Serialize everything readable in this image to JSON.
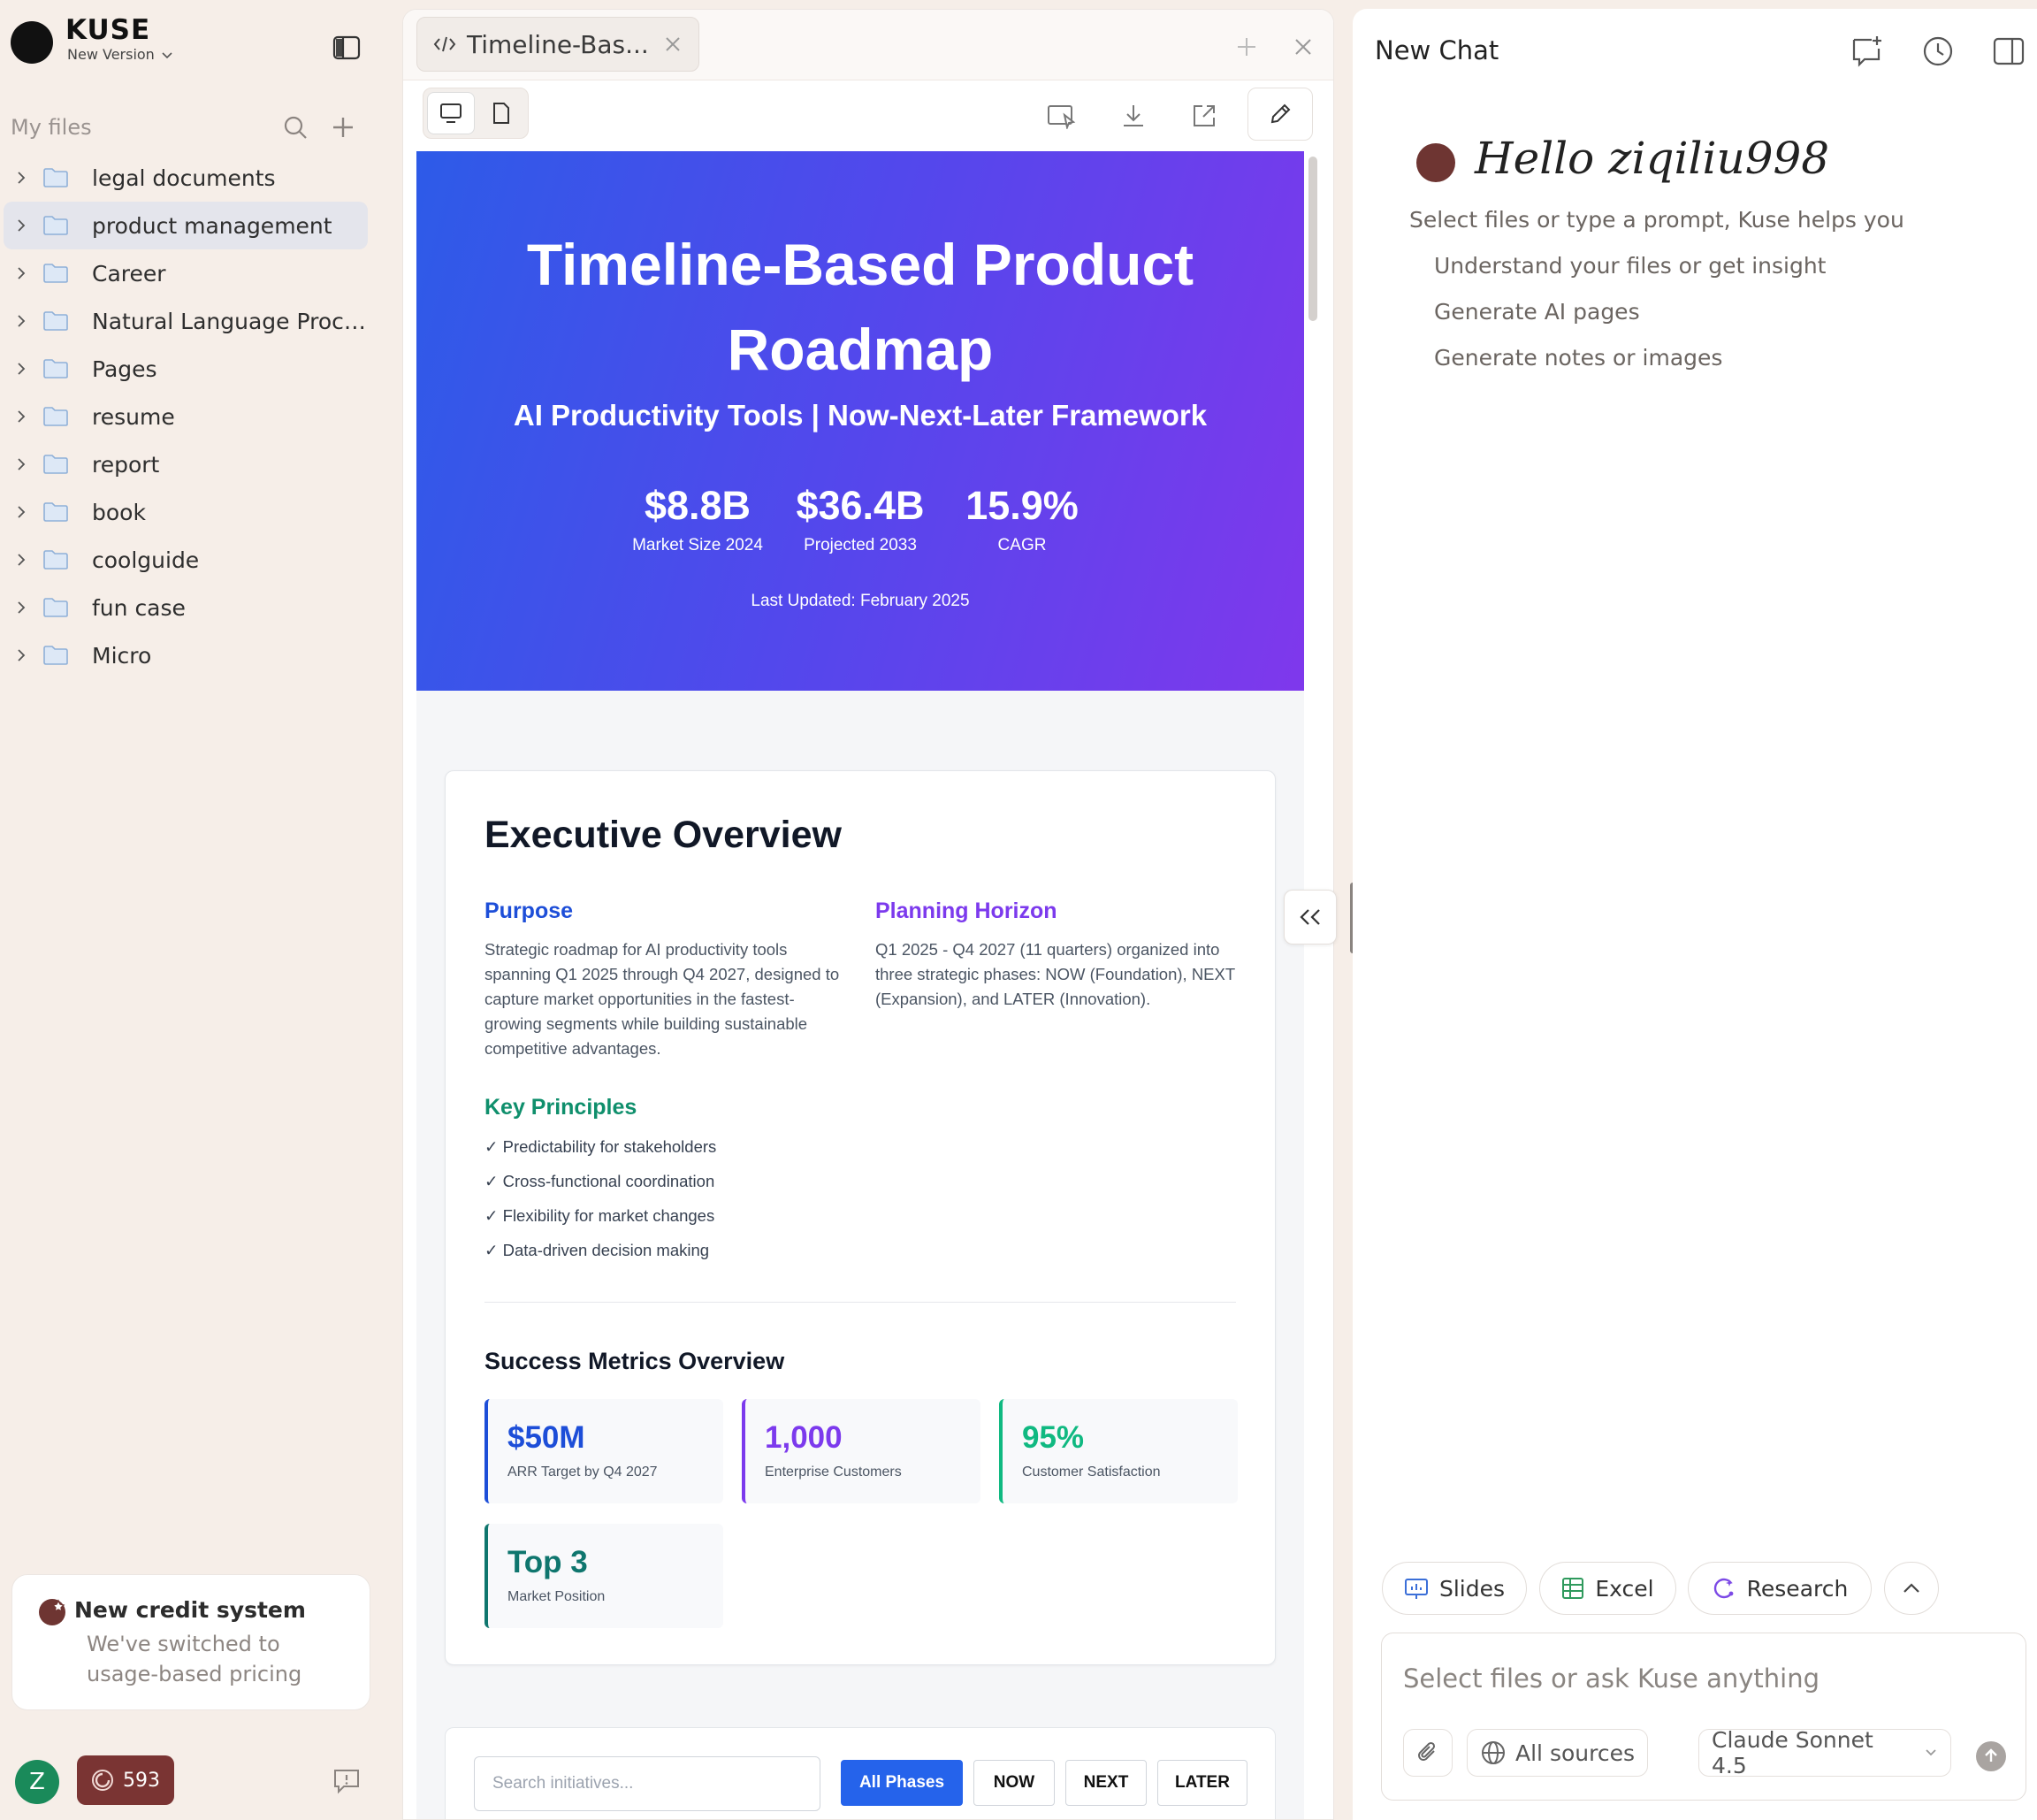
{
  "sidebar": {
    "brand": "KUSE",
    "version_label": "New Version",
    "section_label": "My files",
    "items": [
      {
        "label": "legal documents"
      },
      {
        "label": "product management"
      },
      {
        "label": "Career"
      },
      {
        "label": "Natural Language Proce..."
      },
      {
        "label": "Pages"
      },
      {
        "label": "resume"
      },
      {
        "label": "report"
      },
      {
        "label": "book"
      },
      {
        "label": "coolguide"
      },
      {
        "label": "fun case"
      },
      {
        "label": "Micro"
      }
    ],
    "active_item": "product management",
    "credit_notice": {
      "title": "New credit system",
      "description": "We've switched to usage-based pricing"
    },
    "avatar_initial": "Z",
    "credits": "593"
  },
  "center": {
    "tab_title": "Timeline-Bas...",
    "page": {
      "hero": {
        "title": "Timeline-Based Product Roadmap",
        "subtitle": "AI Productivity Tools | Now-Next-Later Framework",
        "stats": [
          {
            "value": "$8.8B",
            "label": "Market Size 2024"
          },
          {
            "value": "$36.4B",
            "label": "Projected 2033"
          },
          {
            "value": "15.9%",
            "label": "CAGR"
          }
        ],
        "updated": "Last Updated: February 2025"
      },
      "overview": {
        "title": "Executive Overview",
        "purpose_heading": "Purpose",
        "purpose_text": "Strategic roadmap for AI productivity tools spanning Q1 2025 through Q4 2027, designed to capture market opportunities in the fastest-growing segments while building sustainable competitive advantages.",
        "horizon_heading": "Planning Horizon",
        "horizon_text": "Q1 2025 - Q4 2027 (11 quarters) organized into three strategic phases: NOW (Foundation), NEXT (Expansion), and LATER (Innovation).",
        "principles_heading": "Key Principles",
        "principles": [
          "✓ Predictability for stakeholders",
          "✓ Cross-functional coordination",
          "✓ Flexibility for market changes",
          "✓ Data-driven decision making"
        ],
        "metrics_heading": "Success Metrics Overview",
        "metrics": [
          {
            "value": "$50M",
            "label": "ARR Target by Q4 2027",
            "color": "#1d4ed8"
          },
          {
            "value": "1,000",
            "label": "Enterprise Customers",
            "color": "#7c3aed"
          },
          {
            "value": "95%",
            "label": "Customer Satisfaction",
            "color": "#10b981"
          },
          {
            "value": "Top 3",
            "label": "Market Position",
            "color": "#0f766e"
          }
        ]
      },
      "filter": {
        "search_placeholder": "Search initiatives...",
        "phases": [
          "All Phases",
          "NOW",
          "NEXT",
          "LATER"
        ],
        "selected_phase": "All Phases"
      }
    }
  },
  "chat": {
    "title": "New Chat",
    "greeting": "Hello ziqiliu998",
    "intro": "Select files or type a prompt, Kuse helps you",
    "suggestions": [
      "Understand your files or get insight",
      "Generate AI pages",
      "Generate notes or images"
    ],
    "quick_actions": [
      "Slides",
      "Excel",
      "Research"
    ],
    "input_placeholder": "Select files or ask Kuse anything",
    "sources_label": "All sources",
    "model_label": "Claude Sonnet 4.5"
  },
  "colors": {
    "accent_blue": "#2563eb",
    "hero_gradient_start": "#2d5be8",
    "hero_gradient_end": "#7f38ec",
    "credit_pill": "#7a3433",
    "avatar": "#1a8a5a"
  }
}
